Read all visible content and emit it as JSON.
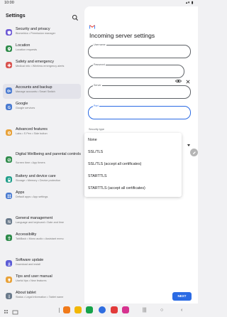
{
  "status_bar": {
    "time": "10:00",
    "system_icons": "signal-wifi-battery-icons"
  },
  "sidebar": {
    "title": "Settings",
    "items": [
      {
        "title": "Security and privacy",
        "subtitle": "Biometrics  •  Permission manager",
        "icon": "shield-icon",
        "color": "#6f5bd6"
      },
      {
        "title": "Location",
        "subtitle": "Location requests",
        "icon": "location-pin-icon",
        "color": "#2e8b4a"
      },
      {
        "title": "Safety and emergency",
        "subtitle": "Medical info  •  Wireless emergency alerts",
        "icon": "emergency-icon",
        "color": "#d9534f"
      },
      {
        "title": "Accounts and backup",
        "subtitle": "Manage accounts  •  Smart Switch",
        "icon": "key-icon",
        "color": "#4a7bd1"
      },
      {
        "title": "Google",
        "subtitle": "Google services",
        "icon": "google-icon",
        "color": "#4a7bd1"
      },
      {
        "title": "Advanced features",
        "subtitle": "Labs  •  S Pen  •  Side button",
        "icon": "star-gear-icon",
        "color": "#e8a23a"
      },
      {
        "title": "Digital Wellbeing and parental controls",
        "subtitle": "Screen time  •  App timers",
        "icon": "wellbeing-icon",
        "color": "#2e8b4a"
      },
      {
        "title": "Battery and device care",
        "subtitle": "Storage  •  Memory  •  Device protection",
        "icon": "battery-icon",
        "color": "#1f9e8a"
      },
      {
        "title": "Apps",
        "subtitle": "Default apps  •  App settings",
        "icon": "apps-grid-icon",
        "color": "#4a7bd1"
      },
      {
        "title": "General management",
        "subtitle": "Language and keyboard  •  Date and time",
        "icon": "sliders-icon",
        "color": "#6b7b8c"
      },
      {
        "title": "Accessibility",
        "subtitle": "TalkBack  •  Mono audio  •  Assistant menu",
        "icon": "accessibility-icon",
        "color": "#2e8b4a"
      },
      {
        "title": "Software update",
        "subtitle": "Download and install",
        "icon": "update-icon",
        "color": "#5b5bd6"
      },
      {
        "title": "Tips and user manual",
        "subtitle": "Useful tips  •  New features",
        "icon": "lightbulb-icon",
        "color": "#e8a23a"
      },
      {
        "title": "About tablet",
        "subtitle": "Status  •  Legal information  •  Tablet name",
        "icon": "info-icon",
        "color": "#6b7b8c"
      }
    ]
  },
  "panel": {
    "title": "Incoming server settings",
    "fields": {
      "username_label": "Username",
      "password_label": "Password",
      "server_label": "Server",
      "port_label": "Port"
    },
    "security_label": "Security type",
    "security_options": [
      "None",
      "SSL/TLS",
      "SSL/TLS (accept all certificates)",
      "STARTTLS",
      "STARTTLS (accept all certificates)"
    ],
    "next_label": "NEXT"
  },
  "colors": {
    "accent": "#2b6be4",
    "selected_row": "#e3e3ea"
  },
  "navbar": {
    "apps": [
      {
        "name": "orange-app-icon",
        "color": "#f07a1a"
      },
      {
        "name": "yellow-app-icon",
        "color": "#f2b705"
      },
      {
        "name": "green-app-icon",
        "color": "#16a34a"
      },
      {
        "name": "blue-app-icon",
        "color": "#2f6de0"
      },
      {
        "name": "red-app-icon",
        "color": "#e23a3a"
      },
      {
        "name": "pink-app-icon",
        "color": "#d6338f"
      }
    ],
    "recents": "|||",
    "home": "○",
    "back": "‹"
  }
}
